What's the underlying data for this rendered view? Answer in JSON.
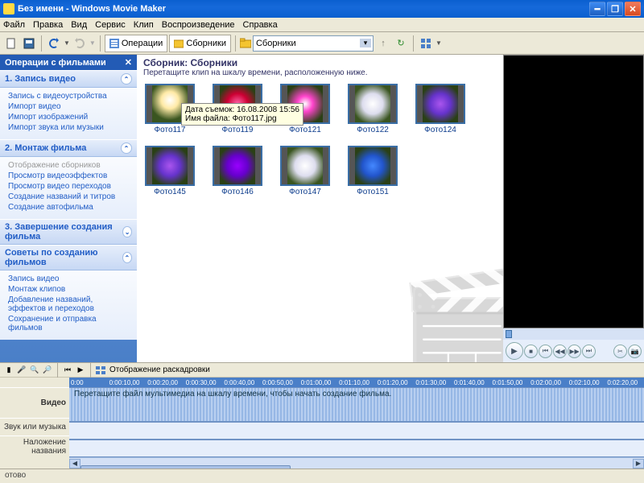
{
  "window": {
    "title": "Без имени - Windows Movie Maker"
  },
  "menu": {
    "file": "Файл",
    "edit": "Правка",
    "view": "Вид",
    "service": "Сервис",
    "clip": "Клип",
    "play": "Воспроизведение",
    "help": "Справка"
  },
  "toolbar": {
    "tasks": "Операции",
    "collections": "Сборники",
    "dropdown_value": "Сборники"
  },
  "taskpane": {
    "title": "Операции с фильмами",
    "s1": {
      "head": "1. Запись видео",
      "items": [
        "Запись с видеоустройства",
        "Импорт видео",
        "Импорт изображений",
        "Импорт звука или музыки"
      ]
    },
    "s2": {
      "head": "2. Монтаж фильма",
      "items_disabled": "Отображение сборников",
      "items": [
        "Просмотр видеоэффектов",
        "Просмотр видео переходов",
        "Создание названий и титров",
        "Создание автофильма"
      ]
    },
    "s3": {
      "head": "3. Завершение создания фильма"
    },
    "tips": {
      "head": "Советы по созданию фильмов",
      "items": [
        "Запись видео",
        "Монтаж клипов",
        "Добавление названий, эффектов и переходов",
        "Сохранение и отправка фильмов"
      ]
    }
  },
  "collection": {
    "title": "Сборник: Сборники",
    "subtitle": "Перетащите клип на шкалу времени, расположенную ниже.",
    "thumbs": [
      {
        "cap": "Фото117",
        "cls": "flower-lily"
      },
      {
        "cap": "Фото119",
        "cls": "flower-pink"
      },
      {
        "cap": "Фото121",
        "cls": "flower-mag"
      },
      {
        "cap": "Фото122",
        "cls": "flower-wh"
      },
      {
        "cap": "Фото124",
        "cls": "flower-viol"
      },
      {
        "cap": "Фото145",
        "cls": "flower-viol"
      },
      {
        "cap": "Фото146",
        "cls": "flower-pur"
      },
      {
        "cap": "Фото147",
        "cls": "flower-wh"
      },
      {
        "cap": "Фото151",
        "cls": "flower-blue"
      }
    ],
    "tooltip_l1": "Дата съемок: 16.08.2008 15:56",
    "tooltip_l2": "Имя файла: Фото117.jpg"
  },
  "timeline": {
    "storyboard_label": "Отображение раскадровки",
    "ruler": [
      "0:00",
      "0:00:10,00",
      "0:00:20,00",
      "0:00:30,00",
      "0:00:40,00",
      "0:00:50,00",
      "0:01:00,00",
      "0:01:10,00",
      "0:01:20,00",
      "0:01:30,00",
      "0:01:40,00",
      "0:01:50,00",
      "0:02:00,00",
      "0:02:10,00",
      "0:02:20,00"
    ],
    "rows": {
      "video": "Видео",
      "audio": "Звук или музыка",
      "title": "Наложение названия"
    },
    "placeholder": "Перетащите файл мультимедиа на шкалу времени, чтобы начать создание фильма."
  },
  "status": "отово"
}
